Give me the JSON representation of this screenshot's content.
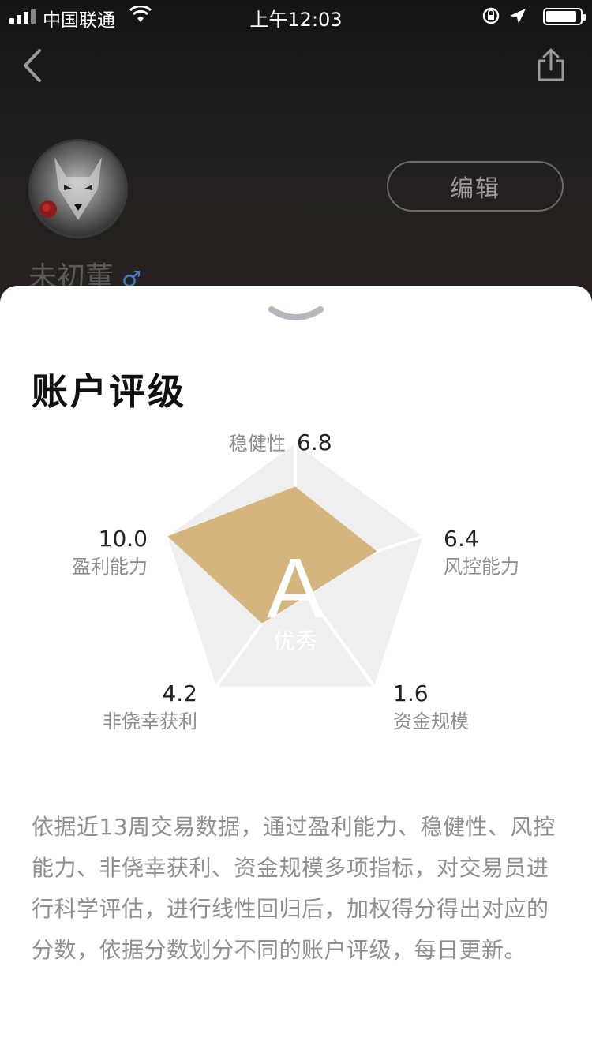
{
  "status_bar": {
    "carrier": "中国联通",
    "time": "上午12:03",
    "battery_level": 0.9
  },
  "profile": {
    "username": "未初董",
    "gender_icon": "male-icon",
    "edit_label": "编辑"
  },
  "sheet": {
    "title": "账户评级",
    "grade": "A",
    "grade_label": "优秀",
    "accent_color": "#d4b57d",
    "metrics": [
      {
        "label": "稳健性",
        "value": "6.8"
      },
      {
        "label": "风控能力",
        "value": "6.4"
      },
      {
        "label": "资金规模",
        "value": "1.6"
      },
      {
        "label": "非侥幸获利",
        "value": "4.2"
      },
      {
        "label": "盈利能力",
        "value": "10.0"
      }
    ],
    "description": "依据近13周交易数据，通过盈利能力、稳健性、风控能力、非侥幸获利、资金规模多项指标，对交易员进行科学评估，进行线性回归后，加权得分得出对应的分数，依据分数划分不同的账户评级，每日更新。"
  }
}
